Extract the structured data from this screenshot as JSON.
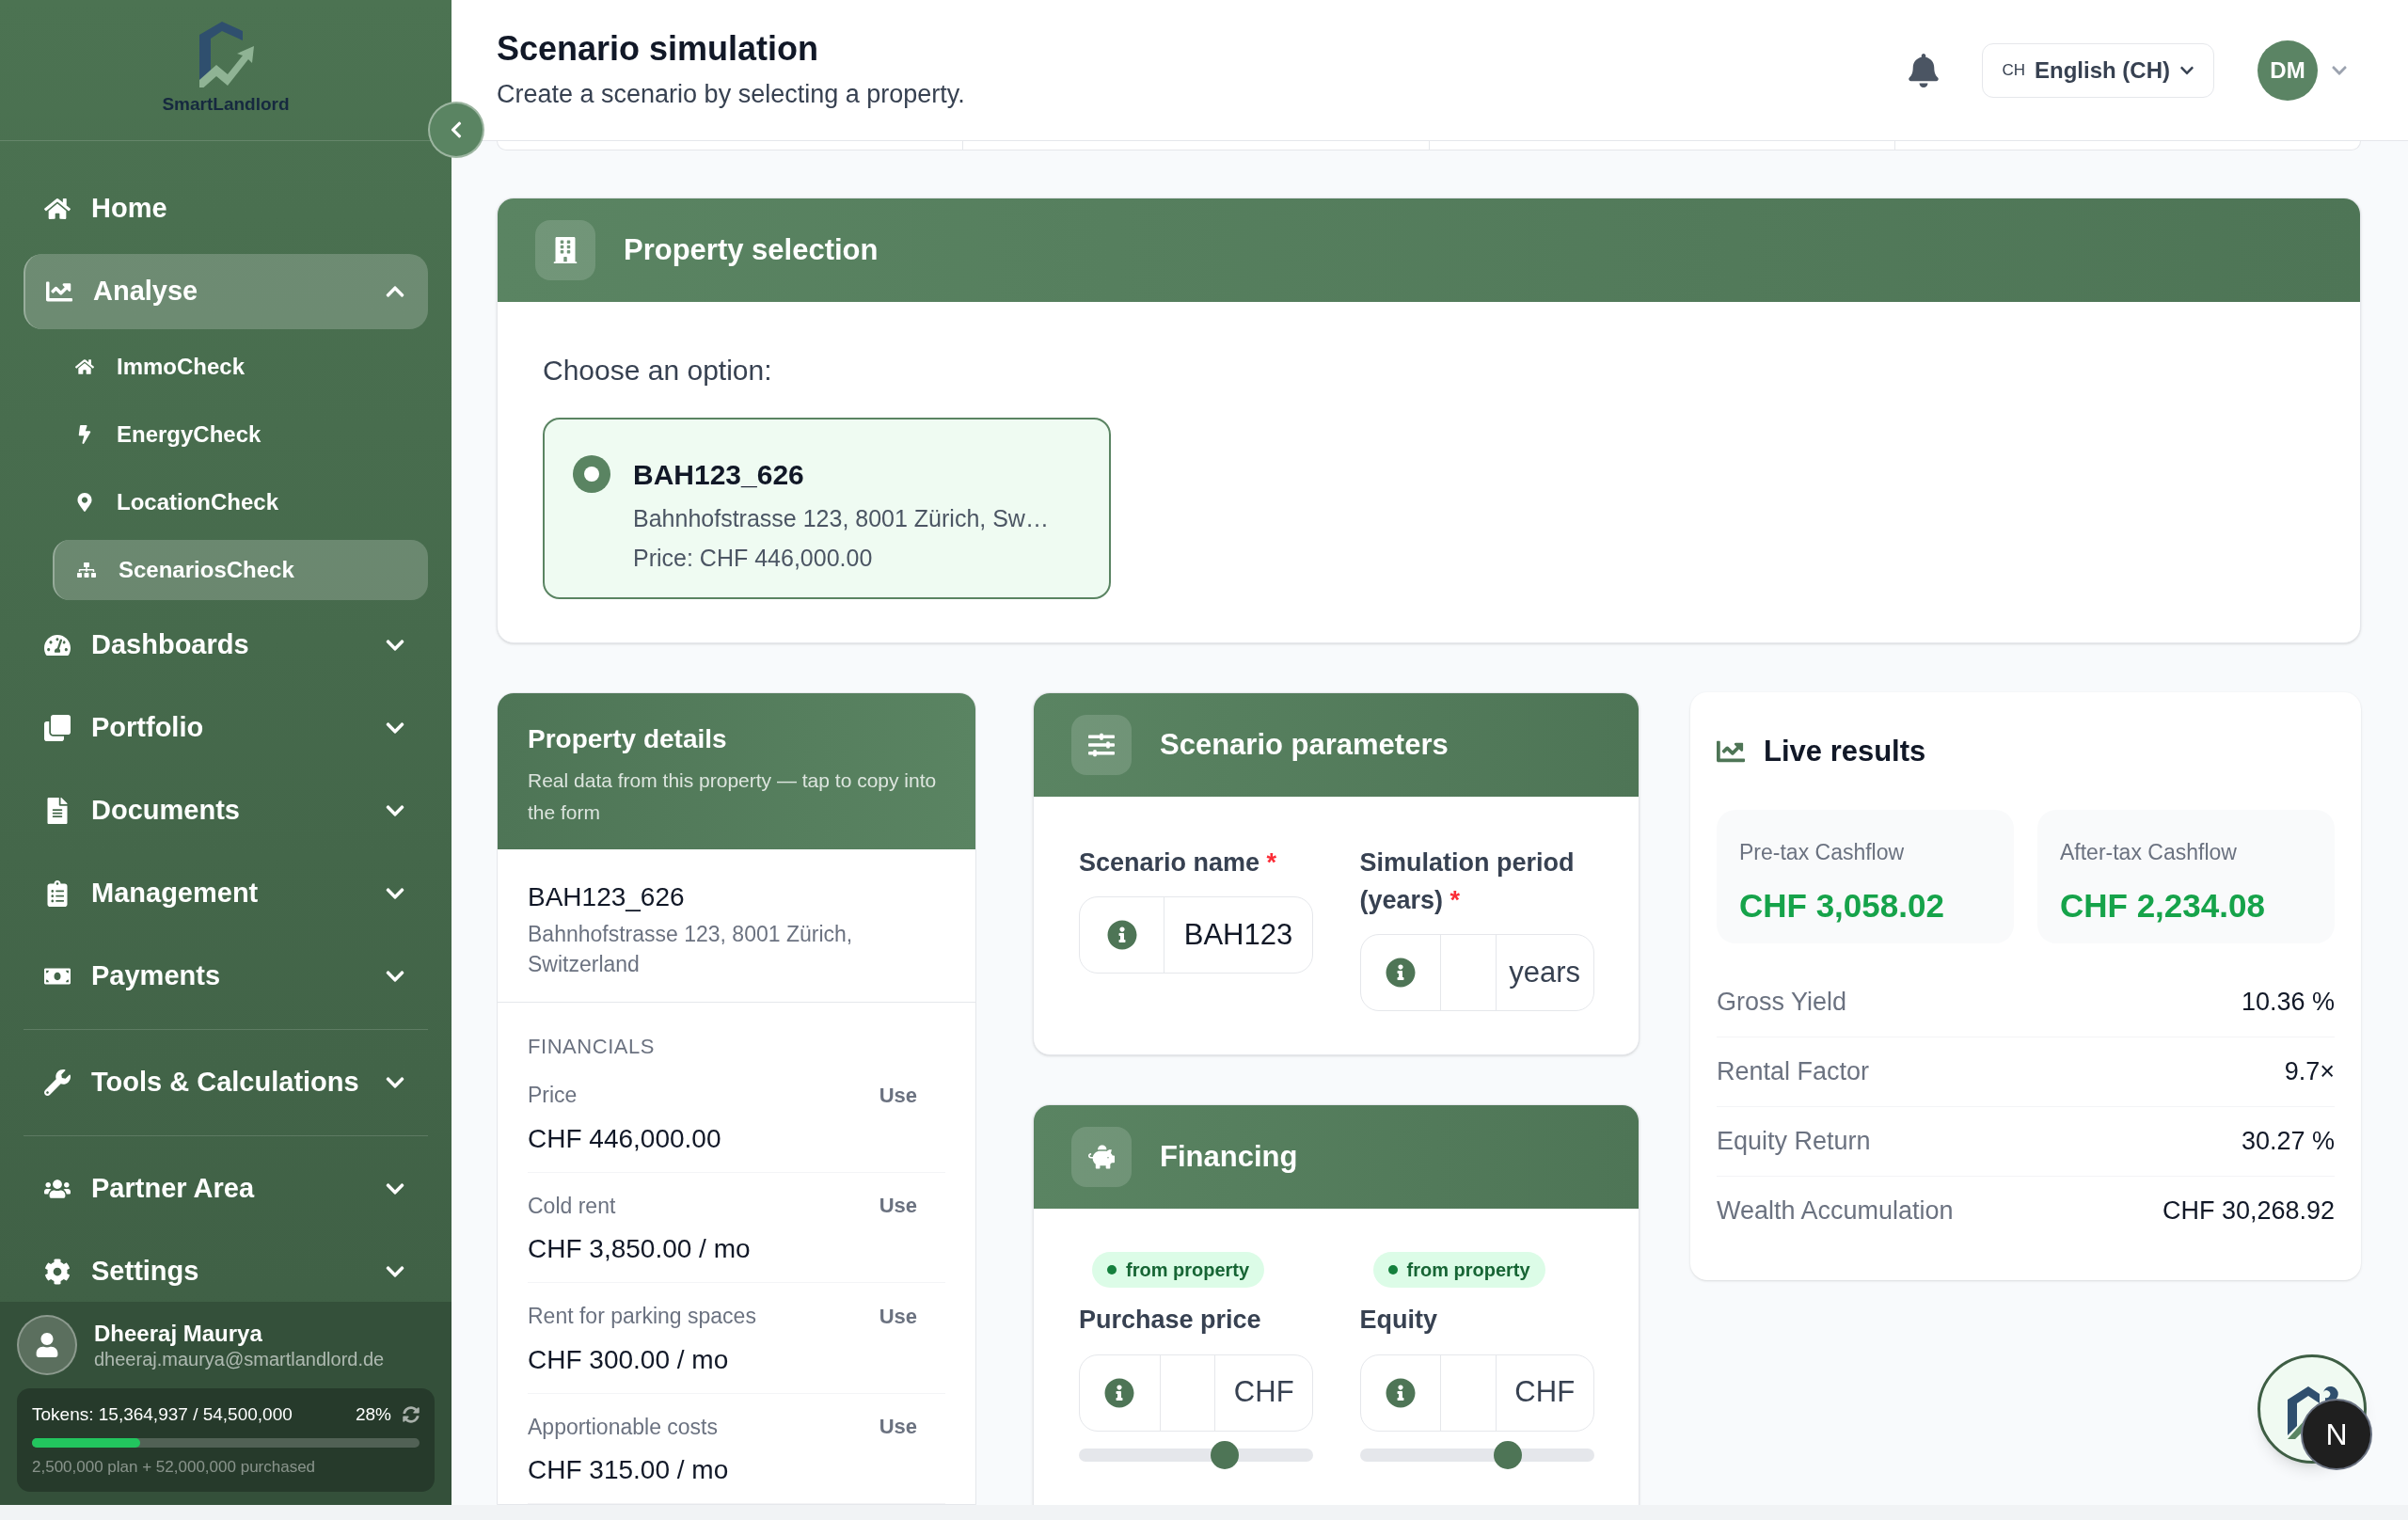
{
  "sidebar": {
    "logo_text": "SmartLandlord",
    "sections": [
      {
        "items": [
          {
            "label": "Home",
            "selected": false
          },
          {
            "label": "Analyse",
            "selected": true,
            "expanded": true,
            "children": [
              {
                "label": "ImmoCheck",
                "selected": false
              },
              {
                "label": "EnergyCheck",
                "selected": false
              },
              {
                "label": "LocationCheck",
                "selected": false
              },
              {
                "label": "ScenariosCheck",
                "selected": true
              }
            ]
          },
          {
            "label": "Dashboards",
            "selected": false,
            "expanded": false
          },
          {
            "label": "Portfolio",
            "selected": false,
            "expanded": false
          },
          {
            "label": "Documents",
            "selected": false,
            "expanded": false
          },
          {
            "label": "Management",
            "selected": false,
            "expanded": false
          },
          {
            "label": "Payments",
            "selected": false,
            "expanded": false
          }
        ]
      },
      {
        "items": [
          {
            "label": "Tools & Calculations",
            "selected": false,
            "expanded": false
          }
        ]
      },
      {
        "items": [
          {
            "label": "Partner Area",
            "selected": false,
            "expanded": false
          },
          {
            "label": "Settings",
            "selected": false,
            "expanded": false
          }
        ]
      }
    ],
    "user": {
      "name": "Dheeraj Maurya",
      "email": "dheeraj.maurya@smartlandlord.de"
    },
    "tokens": {
      "label": "Tokens: 15,364,937 / 54,500,000",
      "percent": "28%",
      "level": 0.28,
      "detail": "2,500,000 plan + 52,000,000 purchased"
    }
  },
  "header": {
    "title": "Scenario simulation",
    "subtitle": "Create a scenario by selecting a property.",
    "language": {
      "region": "CH",
      "label": "English (CH)"
    },
    "avatar": "DM"
  },
  "property_selection": {
    "title": "Property selection",
    "prompt": "Choose an option:",
    "options": [
      {
        "name": "BAH123_626",
        "address": "Bahnhofstrasse 123, 8001 Zürich, Sw…",
        "price": "Price: CHF 446,000.00",
        "selected": true
      }
    ]
  },
  "property_details": {
    "title": "Property details",
    "subtitle": "Real data from this property — tap to copy into the form",
    "name": "BAH123_626",
    "address": "Bahnhofstrasse 123, 8001 Zürich, Switzerland",
    "section": "FINANCIALS",
    "rows": [
      {
        "label": "Price",
        "value": "CHF 446,000.00",
        "action": "Use"
      },
      {
        "label": "Cold rent",
        "value": "CHF 3,850.00 / mo",
        "action": "Use"
      },
      {
        "label": "Rent for parking spaces",
        "value": "CHF 300.00 / mo",
        "action": "Use"
      },
      {
        "label": "Apportionable costs",
        "value": "CHF 315.00 / mo",
        "action": "Use"
      }
    ]
  },
  "scenario_parameters": {
    "title": "Scenario parameters",
    "fields": [
      {
        "label": "Scenario name",
        "required_mark": "*",
        "value": "BAH123"
      },
      {
        "label": "Simulation period (years)",
        "required_mark": "*",
        "suffix": "years"
      }
    ]
  },
  "financing": {
    "title": "Financing",
    "fields": [
      {
        "badge": "from property",
        "label": "Purchase price",
        "suffix": "CHF",
        "level": 0.64
      },
      {
        "badge": "from property",
        "label": "Equity",
        "suffix": "CHF",
        "level": 0.65
      }
    ]
  },
  "live_results": {
    "title": "Live results",
    "kpis": [
      {
        "label": "Pre-tax Cashflow",
        "value": "CHF 3,058.02"
      },
      {
        "label": "After-tax Cashflow",
        "value": "CHF 2,234.08"
      }
    ],
    "rows": [
      {
        "label": "Gross Yield",
        "value": "10.36 %"
      },
      {
        "label": "Rental Factor",
        "value": "9.7×"
      },
      {
        "label": "Equity Return",
        "value": "30.27 %"
      },
      {
        "label": "Wealth Accumulation",
        "value": "CHF 30,268.92"
      }
    ]
  },
  "dev_badge": "N"
}
